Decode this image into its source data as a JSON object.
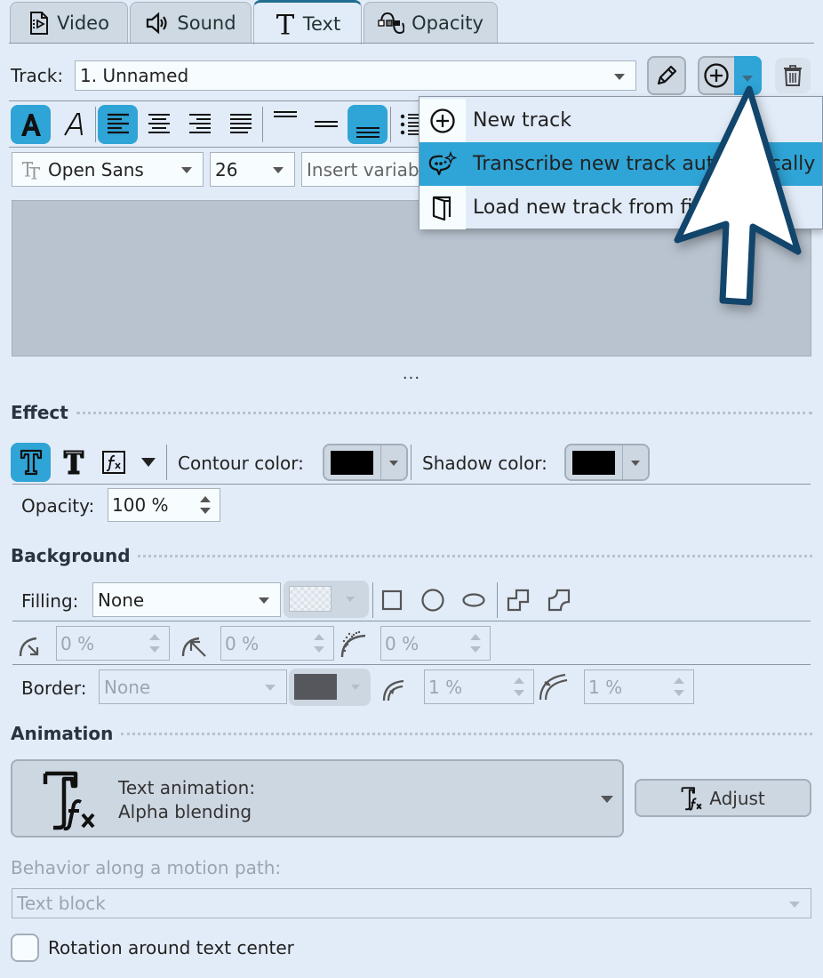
{
  "tabs": [
    {
      "label": "Video",
      "icon": "video-file-icon",
      "active": false
    },
    {
      "label": "Sound",
      "icon": "speaker-icon",
      "active": false
    },
    {
      "label": "Text",
      "icon": "text-t-icon",
      "active": true
    },
    {
      "label": "Opacity",
      "icon": "opacity-curve-icon",
      "active": false
    }
  ],
  "track": {
    "label": "Track:",
    "value": "1. Unnamed"
  },
  "format_toolbar": {
    "font": "Open Sans",
    "size": "26",
    "insert_variable_placeholder": "Insert variable"
  },
  "track_menu": {
    "items": [
      {
        "label": "New track",
        "icon": "plus-circle-icon",
        "highlighted": false
      },
      {
        "label": "Transcribe new track automatically",
        "icon": "transcribe-chat-sparkle-icon",
        "highlighted": true
      },
      {
        "label": "Load new track from file",
        "icon": "open-file-icon",
        "highlighted": false
      }
    ]
  },
  "ellipsis": "...",
  "effect": {
    "title": "Effect",
    "contour_label": "Contour color:",
    "contour_color": "#000000",
    "shadow_label": "Shadow color:",
    "shadow_color": "#000000",
    "opacity_label": "Opacity:",
    "opacity_value": "100 %"
  },
  "background": {
    "title": "Background",
    "filling_label": "Filling:",
    "filling_value": "None",
    "corner1_value": "0 %",
    "corner2_value": "0 %",
    "corner3_value": "0 %",
    "border_label": "Border:",
    "border_value": "None",
    "border_color": "#55575c",
    "border_width1": "1 %",
    "border_width2": "1 %"
  },
  "animation": {
    "title": "Animation",
    "line1": "Text animation:",
    "line2": "Alpha blending",
    "adjust_label": "Adjust",
    "motion_label": "Behavior along a motion path:",
    "motion_value": "Text block",
    "rotation_label": "Rotation around text center",
    "rotation_checked": false
  },
  "colors": {
    "accent": "#2fa4d6",
    "background": "#e2ecf8",
    "cursor_outline": "#12456b"
  }
}
